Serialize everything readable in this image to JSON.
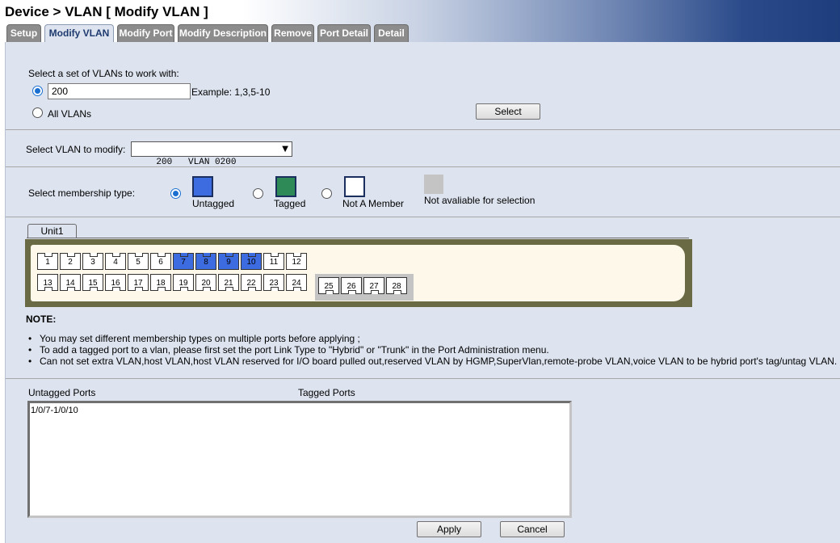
{
  "title": "Device > VLAN [ Modify VLAN ]",
  "tabs": [
    {
      "label": "Setup"
    },
    {
      "label": "Modify VLAN"
    },
    {
      "label": "Modify Port"
    },
    {
      "label": "Modify Description"
    },
    {
      "label": "Remove"
    },
    {
      "label": "Port Detail"
    },
    {
      "label": "Detail"
    }
  ],
  "vlan_set": {
    "prompt": "Select a set of VLANs to work with:",
    "value": "200",
    "example": "Example: 1,3,5-10",
    "all_label": "All VLANs",
    "select_button": "Select"
  },
  "vlan_modify": {
    "label": "Select VLAN to modify:",
    "selected": "200   VLAN 0200"
  },
  "membership": {
    "label": "Select membership type:",
    "untagged": "Untagged",
    "tagged": "Tagged",
    "not_member": "Not A Member",
    "not_available": "Not avaliable for selection",
    "colors": {
      "untagged": "#3d6be0",
      "tagged": "#2e8b57",
      "not_member": "#ffffff",
      "not_available": "#c4c4c4"
    }
  },
  "unit_tab": "Unit1",
  "ports_top": [
    "1",
    "2",
    "3",
    "4",
    "5",
    "6",
    "7",
    "8",
    "9",
    "10",
    "11",
    "12"
  ],
  "ports_bottom": [
    "13",
    "14",
    "15",
    "16",
    "17",
    "18",
    "19",
    "20",
    "21",
    "22",
    "23",
    "24"
  ],
  "ports_sfp": [
    "25",
    "26",
    "27",
    "28"
  ],
  "untagged_ports": [
    "7",
    "8",
    "9",
    "10"
  ],
  "note": {
    "heading": "NOTE:",
    "items": [
      "You may set different membership types on multiple ports before applying ;",
      "To add a tagged port to a vlan, please first set the port Link Type to \"Hybrid\" or \"Trunk\" in the Port Administration menu.",
      "Can not set extra VLAN,host VLAN,host VLAN reserved for I/O board pulled out,reserved VLAN by HGMP,SuperVlan,remote-probe VLAN,voice VLAN to be hybrid port's tag/untag VLAN."
    ]
  },
  "summary": {
    "untagged_header": "Untagged Ports",
    "tagged_header": "Tagged Ports",
    "untagged_value": "1/0/7-1/0/10"
  },
  "buttons": {
    "apply": "Apply",
    "cancel": "Cancel"
  }
}
